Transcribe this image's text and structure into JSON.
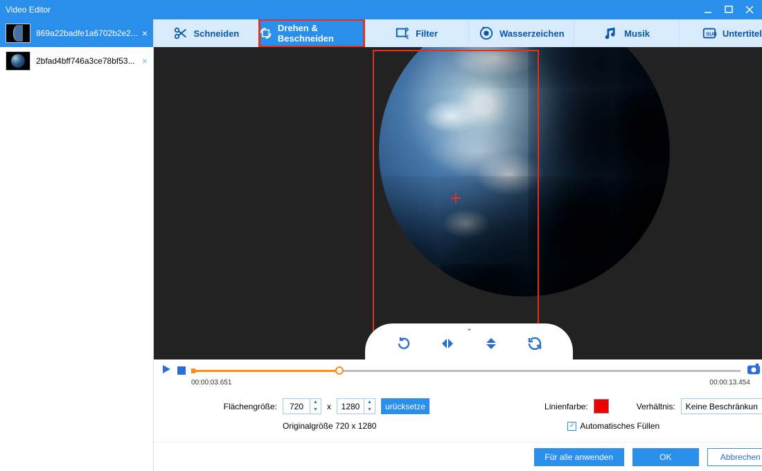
{
  "window": {
    "title": "Video Editor"
  },
  "sidebar": {
    "items": [
      {
        "label": "869a22badfe1a6702b2e2..."
      },
      {
        "label": "2bfad4bff746a3ce78bf53..."
      }
    ]
  },
  "tabs": [
    {
      "id": "cut",
      "label": "Schneiden"
    },
    {
      "id": "rotate",
      "label": "Drehen & Beschneiden"
    },
    {
      "id": "filter",
      "label": "Filter"
    },
    {
      "id": "watermark",
      "label": "Wasserzeichen"
    },
    {
      "id": "music",
      "label": "Musik"
    },
    {
      "id": "subtitle",
      "label": "Untertitel"
    }
  ],
  "timeline": {
    "current": "00:00:03.651",
    "total": "00:00:13.454"
  },
  "controls": {
    "area_label": "Flächengröße:",
    "width": "720",
    "x": "x",
    "height": "1280",
    "reset": "urücksetze",
    "original_label": "Originalgröße 720 x 1280",
    "linecolor_label": "Linienfarbe:",
    "linecolor": "#ee0000",
    "ratio_label": "Verhältnis:",
    "ratio_value": "Keine Beschränkun",
    "autofill_label": "Automatisches Füllen",
    "autofill_checked": true
  },
  "footer": {
    "apply_all": "Für alle anwenden",
    "ok": "OK",
    "cancel": "Abbrechen"
  }
}
